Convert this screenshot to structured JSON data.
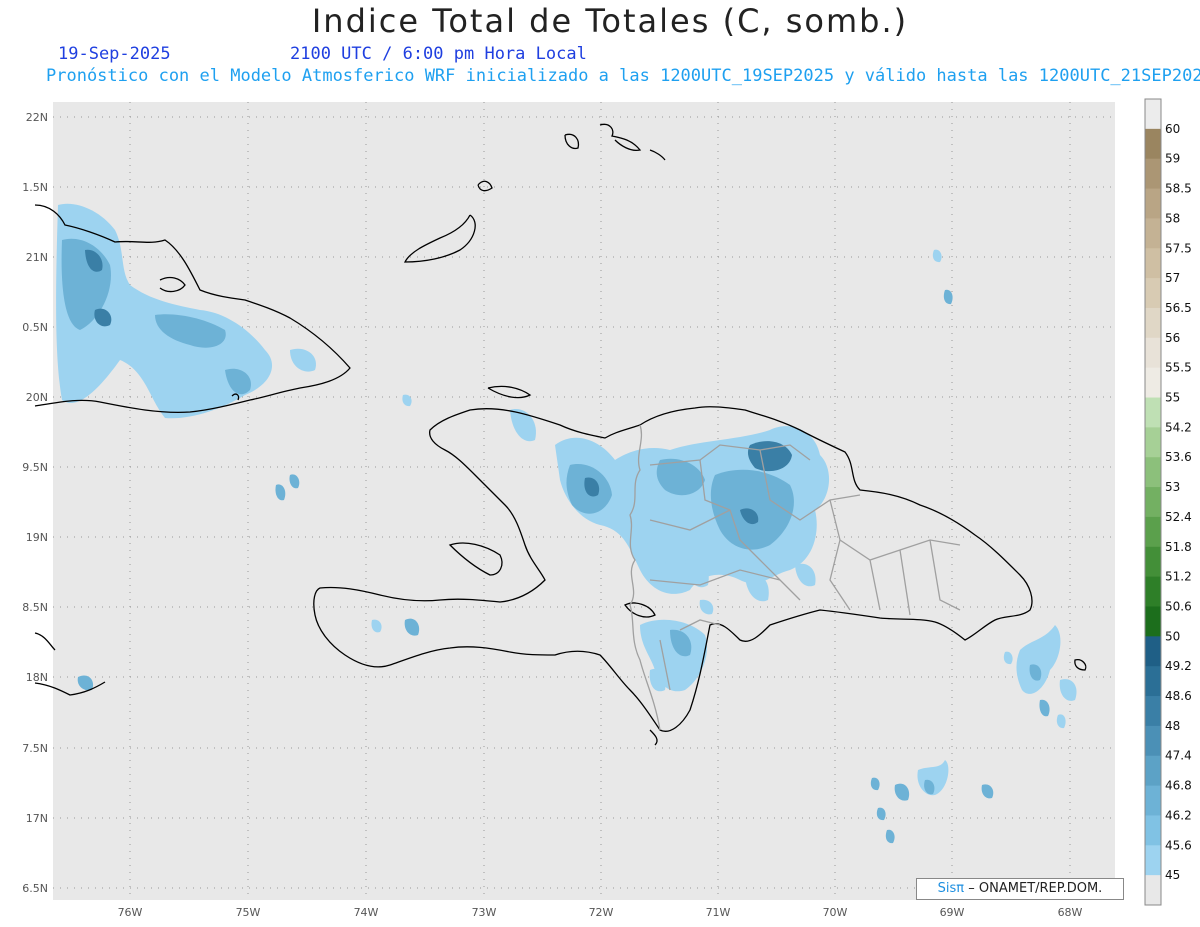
{
  "header": {
    "title": "Indice Total de Totales (C, somb.)",
    "date": "19-Sep-2025",
    "time": "2100 UTC / 6:00 pm Hora Local",
    "forecast": "Pronóstico con el Modelo Atmosferico WRF inicializado a las 1200UTC_19SEP2025 y válido hasta las  1200UTC_21SEP2025"
  },
  "lat_labels": [
    "22N",
    "1.5N",
    "21N",
    "0.5N",
    "20N",
    "9.5N",
    "19N",
    "8.5N",
    "18N",
    "7.5N",
    "17N",
    "6.5N"
  ],
  "lon_labels": [
    "76W",
    "75W",
    "74W",
    "73W",
    "72W",
    "71W",
    "70W",
    "69W",
    "68W"
  ],
  "colorbar": {
    "labels": [
      "60",
      "59",
      "58.5",
      "58",
      "57.5",
      "57",
      "56.5",
      "56",
      "55.5",
      "55",
      "54.2",
      "53.6",
      "53",
      "52.4",
      "51.8",
      "51.2",
      "50.6",
      "50",
      "49.2",
      "48.6",
      "48",
      "47.4",
      "46.8",
      "46.2",
      "45.6",
      "45"
    ],
    "colors": [
      "#ececec",
      "#9a8560",
      "#ab9674",
      "#b9a585",
      "#c4b294",
      "#cfbfa3",
      "#d8cbb3",
      "#e0d7c6",
      "#e8e2d8",
      "#eeebe4",
      "#bfe0b4",
      "#a6d096",
      "#8cc07b",
      "#73b062",
      "#5ba04c",
      "#438f38",
      "#2e7f28",
      "#1c6e1c",
      "#1f5f86",
      "#2b6f96",
      "#3a7fa6",
      "#4b90b6",
      "#5ca2c6",
      "#6db2d6",
      "#80c2e4",
      "#9dd3f0",
      "#e8e8e8"
    ]
  },
  "credit": {
    "sis": "Sisπ",
    "rest": "– ONAMET/REP.DOM."
  },
  "colors": {
    "map_bg": "#e8e8e8",
    "precip_light": "#9dd3f0",
    "precip_mid": "#6db2d6",
    "precip_dark": "#3a7fa6",
    "coast": "#000000",
    "borders": "#999999"
  }
}
